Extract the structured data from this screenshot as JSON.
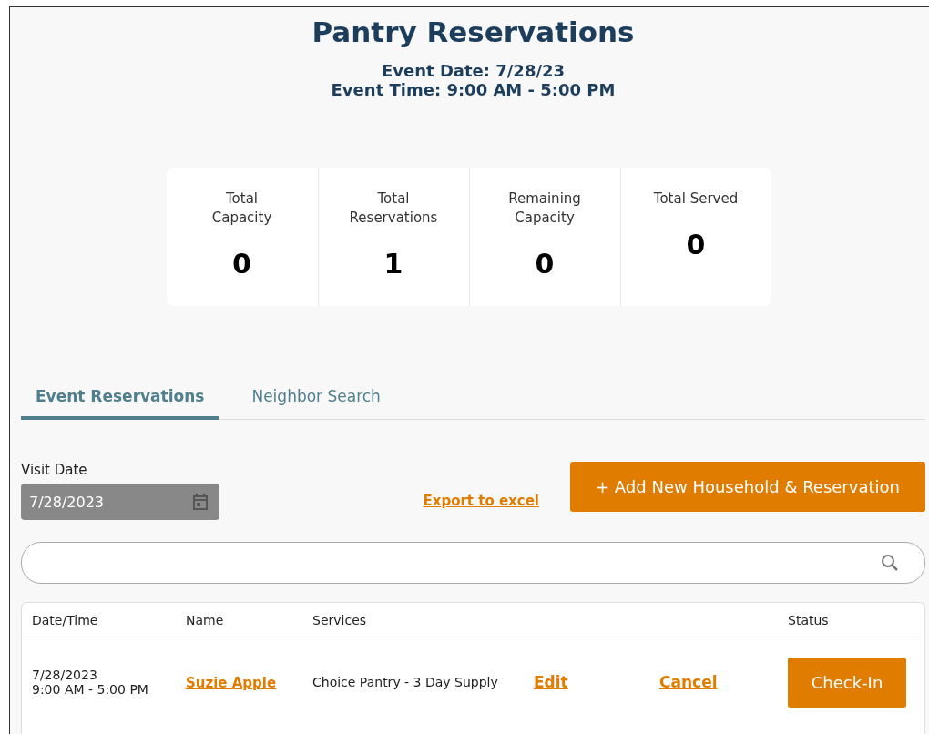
{
  "title": "Pantry Reservations",
  "event_date": "Event Date: 7/28/23",
  "event_time": "Event Time: 9:00 AM - 5:00 PM",
  "stats": [
    {
      "label": "Total Capacity",
      "value": "0"
    },
    {
      "label": "Total Reservations",
      "value": "1"
    },
    {
      "label": "Remaining Capacity",
      "value": "0"
    },
    {
      "label": "Total Served",
      "value": "0"
    }
  ],
  "tabs": [
    {
      "label": "Event Reservations",
      "selected": true
    },
    {
      "label": "Neighbor Search",
      "selected": false
    }
  ],
  "visit_date": {
    "label": "Visit Date",
    "value": "7/28/2023",
    "disabled": true
  },
  "export_link": "Export to excel",
  "add_button": "+ Add New Household & Reservation",
  "table": {
    "columns": [
      "Date/Time",
      "Name",
      "Services",
      "Status"
    ],
    "rows": [
      {
        "date": "7/28/2023",
        "time": "9:00 AM - 5:00 PM",
        "name": "Suzie Apple",
        "service": "Choice Pantry - 3 Day Supply",
        "edit": "Edit",
        "cancel": "Cancel",
        "status": "Check-In"
      }
    ]
  }
}
